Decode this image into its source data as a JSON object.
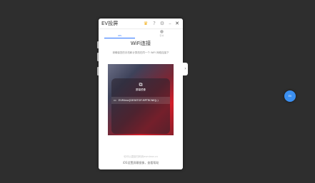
{
  "app": {
    "title": "EV投屏",
    "icons": [
      "crown-icon",
      "help-icon",
      "settings-icon",
      "minimize-icon",
      "close-icon"
    ],
    "close_glyph": "✕"
  },
  "tabs": [
    {
      "label": "iOS",
      "icon": "apple-icon",
      "active": true
    },
    {
      "label": "安卓",
      "icon": "android-icon",
      "active": false
    }
  ],
  "main": {
    "heading": "WiFi连接",
    "description": "请确保您的手机和计算机在同一个 WiFi 网络连接下",
    "mirror": {
      "title": "屏幕镜像",
      "device_name": "EVMirror[DESKTOP-MPTRCN8](-)"
    },
    "footer_note": "也可以直接扫码到evmirror.cn",
    "footer_link": "iOS设置屏幕镜像，查看帮助"
  },
  "float_button": {
    "label": "EV"
  },
  "colors": {
    "accent": "#2a72ff",
    "background": "#2e2e2e",
    "crown": "#f2b01e",
    "bubble": "#3b8ff0"
  }
}
